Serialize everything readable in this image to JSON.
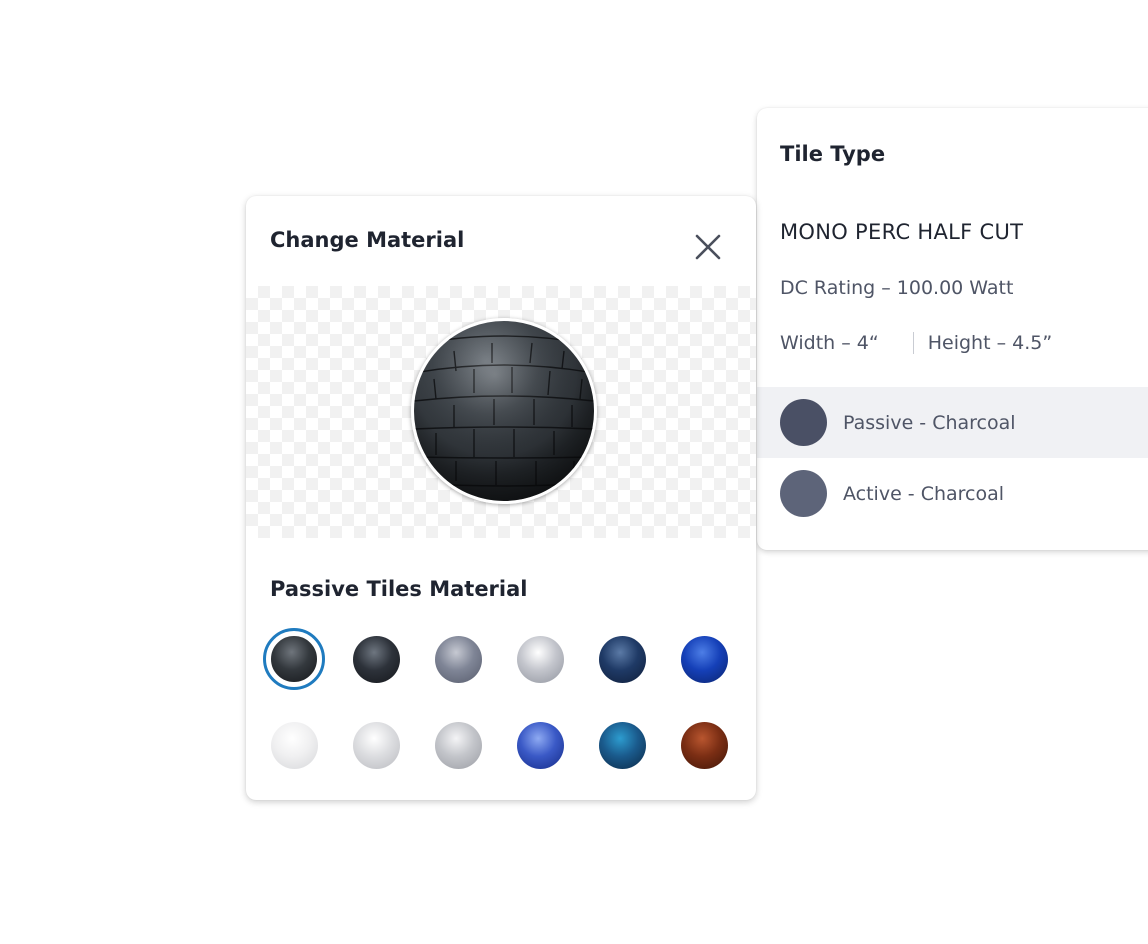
{
  "tile_type": {
    "title": "Tile Type",
    "name": "MONO PERC HALF CUT",
    "dc_rating": "DC Rating – 100.00 Watt",
    "width": "Width – 4“",
    "height": "Height – 4.5”",
    "variants": [
      {
        "label": "Passive - Charcoal",
        "color": "#4a5065",
        "selected": true
      },
      {
        "label": "Active - Charcoal",
        "color": "#5d6479",
        "selected": false
      }
    ]
  },
  "change_material": {
    "title": "Change Material",
    "close_icon": "close-icon",
    "section_title": "Passive Tiles Material",
    "selected_index": 0,
    "swatches": [
      {
        "name": "charcoal-tile-swatch",
        "colors": [
          "#6f757c",
          "#33383d",
          "#15171a"
        ]
      },
      {
        "name": "graphite-swatch",
        "colors": [
          "#6e7680",
          "#2d323a",
          "#14161a"
        ]
      },
      {
        "name": "steel-grey-swatch",
        "colors": [
          "#c6c9d2",
          "#7f8596",
          "#565b6b"
        ]
      },
      {
        "name": "silver-swatch",
        "colors": [
          "#ffffff",
          "#c3c5cc",
          "#8f939d"
        ]
      },
      {
        "name": "navy-swatch",
        "colors": [
          "#5b7aa6",
          "#1f3a66",
          "#0f1d38"
        ]
      },
      {
        "name": "royal-blue-swatch",
        "colors": [
          "#4d7ee6",
          "#1540b8",
          "#0a236c"
        ]
      },
      {
        "name": "white-swatch",
        "colors": [
          "#ffffff",
          "#f0f0f1",
          "#d5d6d9"
        ]
      },
      {
        "name": "light-grey-swatch",
        "colors": [
          "#ffffff",
          "#dcdde0",
          "#b9babf"
        ]
      },
      {
        "name": "pale-grey-swatch",
        "colors": [
          "#f4f4f6",
          "#c3c5ca",
          "#9a9ca3"
        ]
      },
      {
        "name": "cobalt-swatch",
        "colors": [
          "#8eaaf2",
          "#3a59c6",
          "#142a86"
        ]
      },
      {
        "name": "teal-blue-swatch",
        "colors": [
          "#2d9ccf",
          "#1a5a8c",
          "#0c2844"
        ]
      },
      {
        "name": "copper-swatch",
        "colors": [
          "#b9562f",
          "#7b2e14",
          "#3f1507"
        ]
      }
    ]
  }
}
